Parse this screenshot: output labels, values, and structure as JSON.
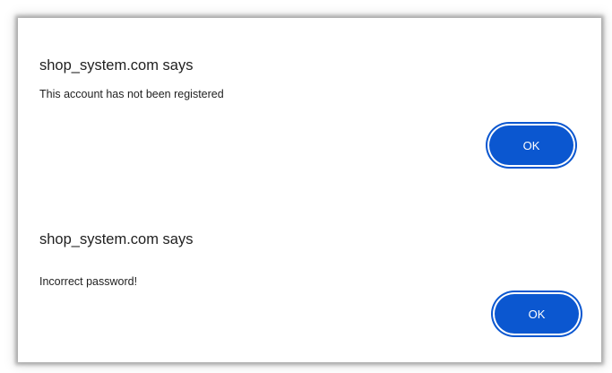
{
  "dialogs": [
    {
      "origin_title": "shop_system.com says",
      "message": "This account has not been registered",
      "ok_label": "OK"
    },
    {
      "origin_title": "shop_system.com says",
      "message": "Incorrect password!",
      "ok_label": "OK"
    }
  ],
  "colors": {
    "button_bg": "#0b57d0",
    "button_text": "#ffffff",
    "text": "#1f1f1f",
    "background": "#ffffff"
  }
}
